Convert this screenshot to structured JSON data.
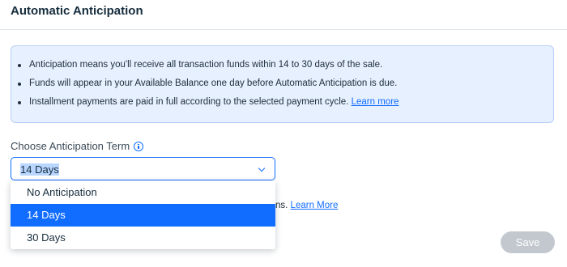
{
  "header": {
    "title": "Automatic Anticipation"
  },
  "info": {
    "items": [
      {
        "text": "Anticipation means you'll receive all transaction funds within 14 to 30 days of the sale."
      },
      {
        "text": "Funds will appear in your Available Balance one day before Automatic Anticipation is due."
      },
      {
        "text": "Installment payments are paid in full according to the selected payment cycle.",
        "link": "Learn more"
      }
    ]
  },
  "term": {
    "label": "Choose Anticipation Term",
    "selected": "14 Days",
    "options": [
      "No Anticipation",
      "14 Days",
      "30 Days"
    ]
  },
  "partial": {
    "text": "ns.",
    "link": "Learn More"
  },
  "actions": {
    "save": "Save"
  },
  "colors": {
    "accent": "#116dff",
    "info_bg": "#e7f0ff",
    "disabled_button": "#c2c8ce"
  }
}
